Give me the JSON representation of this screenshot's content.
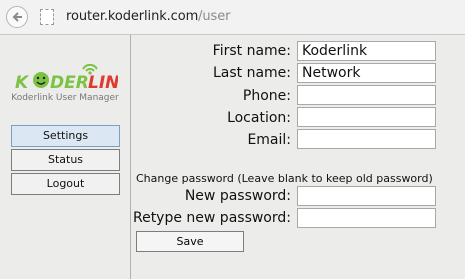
{
  "browser": {
    "url_host": "router.koderlink.com",
    "url_path": "/user"
  },
  "sidebar": {
    "logo_text": "KODERLINK",
    "subtitle": "Koderlink User Manager",
    "items": [
      {
        "label": "Settings",
        "active": true
      },
      {
        "label": "Status",
        "active": false
      },
      {
        "label": "Logout",
        "active": false
      }
    ]
  },
  "form": {
    "first_name": {
      "label": "First name:",
      "value": "Koderlink"
    },
    "last_name": {
      "label": "Last name:",
      "value": "Network"
    },
    "phone": {
      "label": "Phone:",
      "value": ""
    },
    "location": {
      "label": "Location:",
      "value": ""
    },
    "email": {
      "label": "Email:",
      "value": ""
    },
    "password_note": "Change password (Leave blank to keep old password)",
    "new_password": {
      "label": "New password:",
      "value": ""
    },
    "retype_password": {
      "label": "Retype new password:",
      "value": ""
    },
    "save_label": "Save"
  },
  "colors": {
    "logo_green": "#7cc243",
    "logo_red": "#e03a2f",
    "active_button": "#dbe8f4"
  }
}
